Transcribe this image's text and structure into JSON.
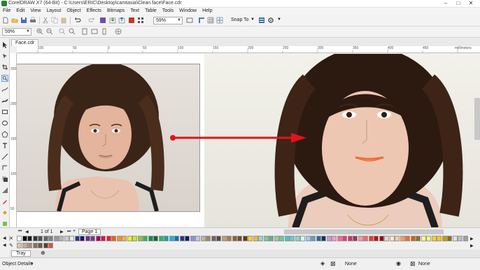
{
  "window": {
    "title": "CorelDRAW X7 (64-Bit) - C:\\Users\\ERIC\\Desktop\\camtasia\\Clean face\\Face.cdr",
    "minimize": "–",
    "maximize": "□",
    "close": "✕"
  },
  "menu": [
    "File",
    "Edit",
    "View",
    "Layout",
    "Object",
    "Effects",
    "Bitmaps",
    "Text",
    "Table",
    "Tools",
    "Window",
    "Help"
  ],
  "toolbar": {
    "zoom_value": "59%",
    "snap_label": "Snap To"
  },
  "propertybar": {
    "zoom_value": "59%"
  },
  "document": {
    "tab_label": "Face.cdr"
  },
  "ruler": {
    "unit": "millimeters",
    "h_labels": [
      "100",
      "50",
      "0",
      "50",
      "100",
      "150",
      "200",
      "250",
      "300",
      "350",
      "400",
      "450"
    ],
    "v_labels": [
      "250",
      "200",
      "150",
      "100",
      "50"
    ]
  },
  "pagenav": {
    "page_counter": "1 of 1",
    "page_tab": "Page 1"
  },
  "tray": {
    "label": "Tray"
  },
  "statusbar": {
    "object_details": "Object Details",
    "fill_none": "None",
    "outline_none": "None",
    "outline2_none": "None"
  },
  "palette": {
    "row1": [
      "#ffffff",
      "#000000",
      "#1a1a1a",
      "#333333",
      "#4d4d4d",
      "#666666",
      "#808080",
      "#999999",
      "#b3b3b3",
      "#cccccc",
      "#e6e6e6",
      "#2e3192",
      "#1b1464",
      "#662d91",
      "#92278f",
      "#9e005d",
      "#d4145a",
      "#ed1c24",
      "#f15a24",
      "#f7931e",
      "#fbb03b",
      "#fcee21",
      "#d9e021",
      "#8cc63f",
      "#39b54a",
      "#009245",
      "#006837",
      "#22b573",
      "#00a99d",
      "#29abe2",
      "#0071bc",
      "#2e3192",
      "#1b1464",
      "#8b8ee3",
      "#b8c9f0",
      "#c7b299",
      "#998675",
      "#736357",
      "#534741",
      "#c69c6d",
      "#a67c52",
      "#8c6239",
      "#754c24",
      "#603813",
      "#f9d423",
      "#e8ba4a",
      "#a0d6b4",
      "#7fc7a4",
      "#5ab38a",
      "#99cc99",
      "#66cc99",
      "#33cccc",
      "#66cccc",
      "#99cccc",
      "#ccffff",
      "#99ccff",
      "#6699cc",
      "#336699",
      "#003366",
      "#cc99cc",
      "#ff99cc",
      "#ff6699",
      "#ff3366",
      "#cc3366",
      "#993366",
      "#ff9999",
      "#ff6666",
      "#ff3333",
      "#cc0000",
      "#990000",
      "#ffcccc",
      "#ffe5cc",
      "#ffcc99",
      "#ff9966",
      "#ff6633",
      "#cc6600",
      "#996633",
      "#ffff99",
      "#ffff66",
      "#ffcc33",
      "#ffcc00",
      "#cc9900",
      "#996600",
      "#e0e0e0",
      "#c0c0c0",
      "#a0a0a0"
    ],
    "row2": [
      "#d9c7b8",
      "#c4a89a",
      "#a88c7e",
      "#8a6f63",
      "#6e564c",
      "#573f36",
      "#e74c3c"
    ]
  },
  "canvas": {
    "arrow_color": "#e0141a"
  }
}
